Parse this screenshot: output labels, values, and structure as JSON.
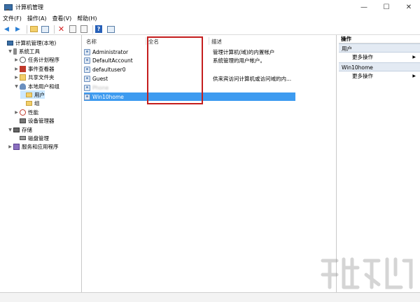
{
  "window": {
    "title": "计算机管理"
  },
  "menu": [
    "文件(F)",
    "操作(A)",
    "查看(V)",
    "帮助(H)"
  ],
  "tree": [
    {
      "label": "计算机管理(本地)",
      "icon": "computer-icon",
      "indent": 0,
      "expander": ""
    },
    {
      "label": "系统工具",
      "icon": "tools-icon",
      "indent": 1,
      "expander": "v"
    },
    {
      "label": "任务计划程序",
      "icon": "clock-icon",
      "indent": 2,
      "expander": ">"
    },
    {
      "label": "事件查看器",
      "icon": "event-log-icon",
      "indent": 2,
      "expander": ">"
    },
    {
      "label": "共享文件夹",
      "icon": "shared-folder-icon",
      "indent": 2,
      "expander": ">"
    },
    {
      "label": "本地用户和组",
      "icon": "users-icon",
      "indent": 2,
      "expander": "v"
    },
    {
      "label": "用户",
      "icon": "folder-icon",
      "indent": 3,
      "expander": "",
      "selected": true
    },
    {
      "label": "组",
      "icon": "folder-icon",
      "indent": 3,
      "expander": ""
    },
    {
      "label": "性能",
      "icon": "performance-icon",
      "indent": 2,
      "expander": ">"
    },
    {
      "label": "设备管理器",
      "icon": "device-icon",
      "indent": 2,
      "expander": ""
    },
    {
      "label": "存储",
      "icon": "storage-icon",
      "indent": 1,
      "expander": "v"
    },
    {
      "label": "磁盘管理",
      "icon": "disk-icon",
      "indent": 2,
      "expander": ""
    },
    {
      "label": "服务和应用程序",
      "icon": "services-icon",
      "indent": 1,
      "expander": ">"
    }
  ],
  "columns": {
    "name": "名称",
    "fullname": "全名",
    "description": "描述"
  },
  "users": [
    {
      "name": "Administrator",
      "fullname": "",
      "description": "管理计算机(域)的内置帐户"
    },
    {
      "name": "DefaultAccount",
      "fullname": "",
      "description": "系统管理的用户帐户。"
    },
    {
      "name": "defaultuser0",
      "fullname": "",
      "description": ""
    },
    {
      "name": "Guest",
      "fullname": "",
      "description": "供来宾访问计算机或访问域的内..."
    },
    {
      "name": "Phone",
      "fullname": "",
      "description": "",
      "blurred": true
    },
    {
      "name": "Win10home",
      "fullname": "",
      "description": "",
      "selected": true
    }
  ],
  "actions": {
    "header": "操作",
    "sections": [
      {
        "title": "用户",
        "items": [
          "更多操作"
        ]
      },
      {
        "title": "Win10home",
        "items": [
          "更多操作"
        ]
      }
    ]
  },
  "colors": {
    "selection": "#3d9bf0",
    "highlight_box": "#c41e1e",
    "section_bg": "#e3eaf3"
  }
}
